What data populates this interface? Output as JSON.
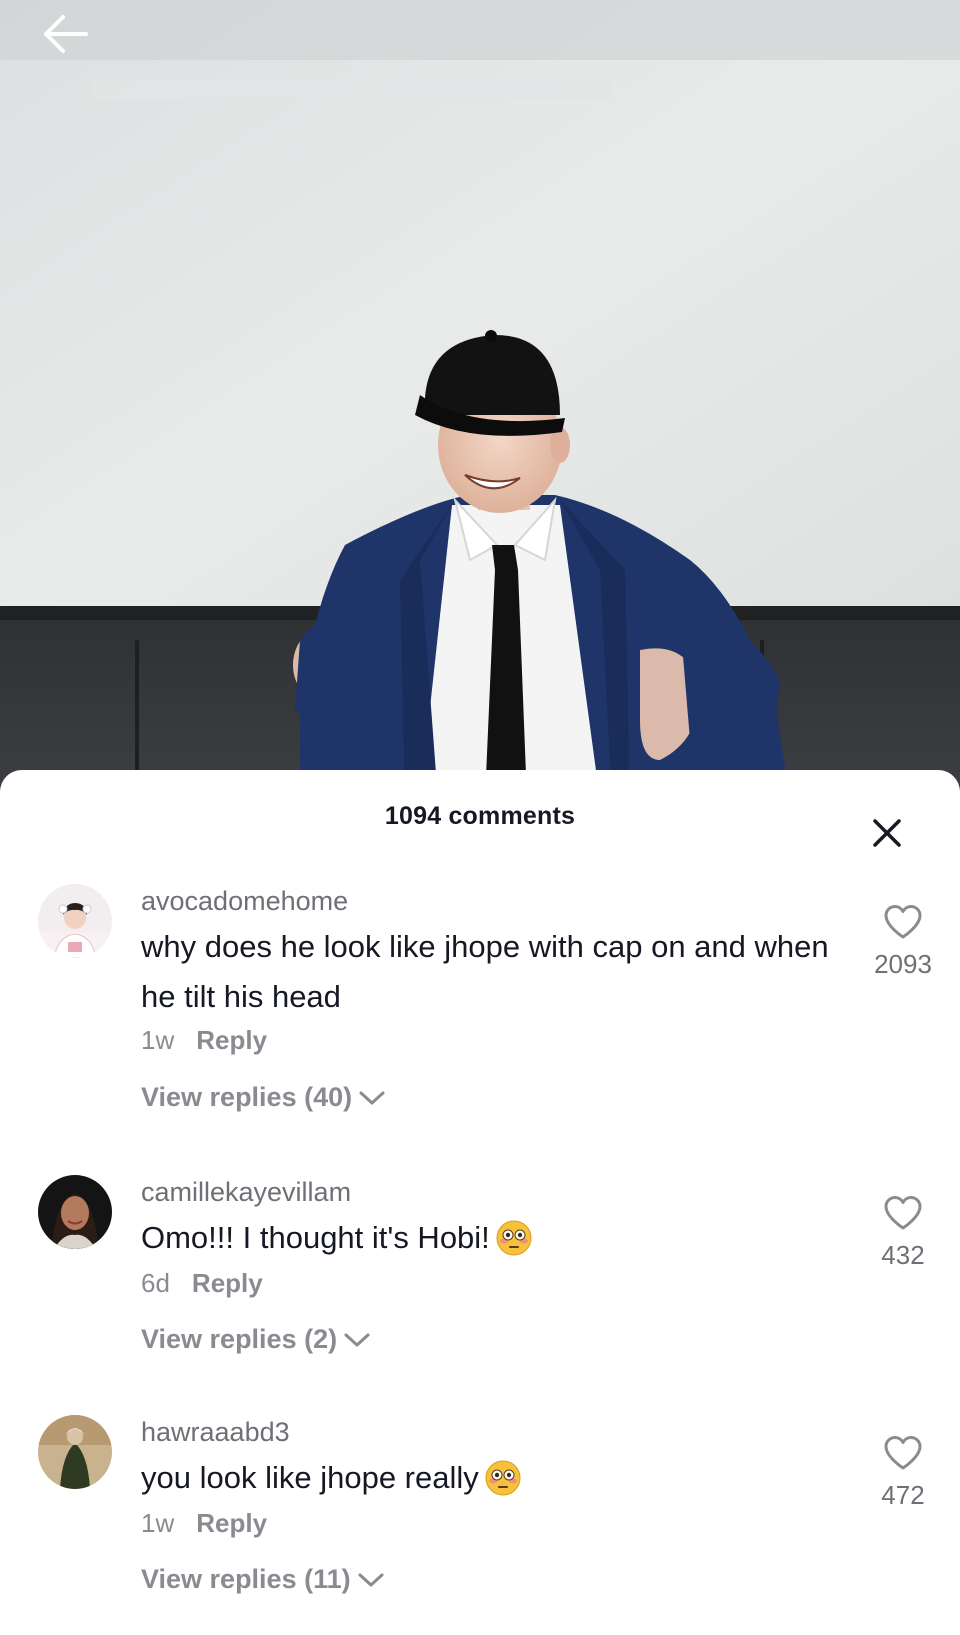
{
  "comments_header": {
    "title": "1094 comments"
  },
  "icons": {
    "back": "arrow-left-icon",
    "close": "close-icon",
    "like": "heart-outline-icon",
    "expand": "chevron-down-icon",
    "emoji": "flushed-face-emoji"
  },
  "colors": {
    "text_primary": "#161823",
    "text_secondary": "#8a8b91",
    "sheet_bg": "#ffffff"
  },
  "comments": [
    {
      "username": "avocadomehome",
      "text": "why does he look like jhope with cap on and when he tilt his head",
      "time": "1w",
      "reply_label": "Reply",
      "view_replies": "View replies (40)",
      "likes": "2093"
    },
    {
      "username": "camillekayevillam",
      "text": "Omo!!! I thought it's Hobi!",
      "emoji": "😳",
      "time": "6d",
      "reply_label": "Reply",
      "view_replies": "View replies (2)",
      "likes": "432"
    },
    {
      "username": "hawraaabd3",
      "text": "you look like jhope really",
      "emoji": "😳",
      "time": "1w",
      "reply_label": "Reply",
      "view_replies": "View replies (11)",
      "likes": "472"
    }
  ]
}
